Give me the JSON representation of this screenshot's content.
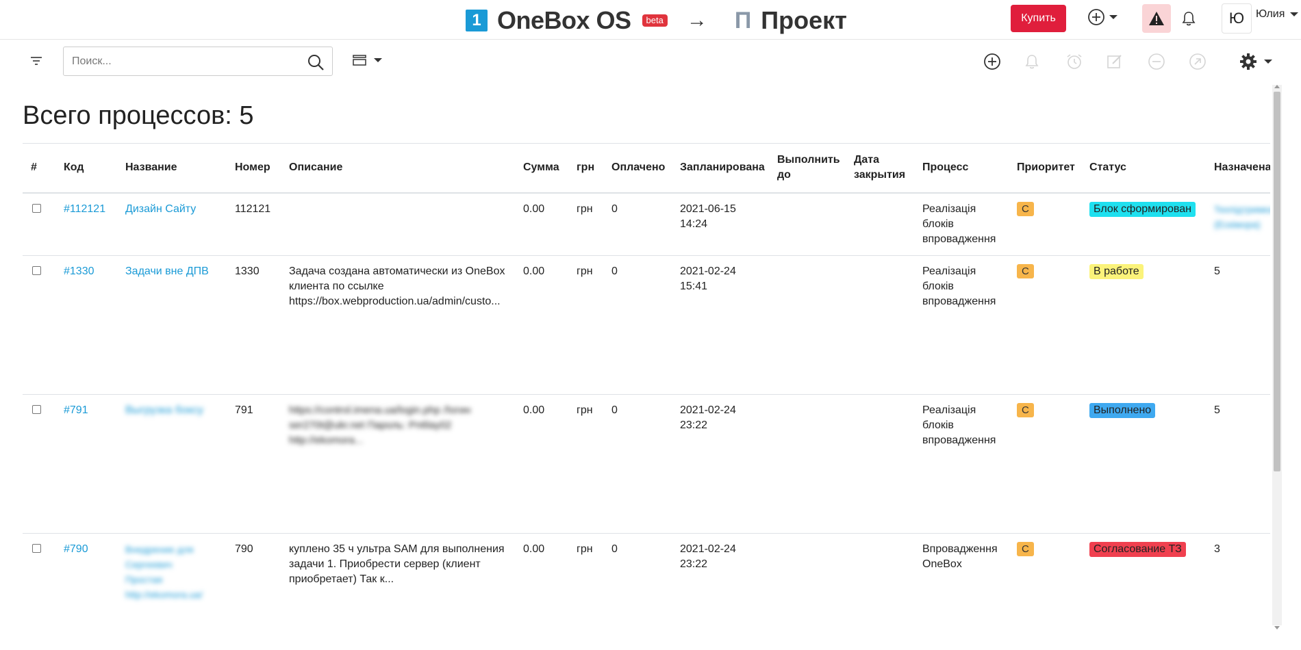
{
  "header": {
    "brand_number": "1",
    "brand_name": "OneBox OS",
    "beta": "beta",
    "arrow": "→",
    "project_icon": "П",
    "project_name": "Проект",
    "buy_label": "Купить",
    "user_initial": "Ю",
    "user_name": "Юлия"
  },
  "toolbar": {
    "search_placeholder": "Поиск...",
    "icons": [
      "plus-circle-icon",
      "bell-icon",
      "alarm-icon",
      "edit-icon",
      "minus-circle-icon",
      "arrow-circle-icon",
      "gear-icon"
    ]
  },
  "main": {
    "title": "Всего процессов: 5"
  },
  "table": {
    "columns": {
      "num": "#",
      "code": "Код",
      "name": "Название",
      "number": "Номер",
      "desc": "Описание",
      "sum": "Сумма",
      "currency": "грн",
      "paid": "Оплачено",
      "planned": "Запланирована",
      "due_1": "Выполнить",
      "due_2": "до",
      "closed_1": "Дата",
      "closed_2": "закрытия",
      "process": "Процесс",
      "priority": "Приоритет",
      "status": "Статус",
      "assigned": "Назначена"
    },
    "rows": [
      {
        "code": "#112121",
        "name": "Дизайн Сайту",
        "number": "112121",
        "desc": "",
        "sum": "0.00",
        "currency": "грн",
        "paid": "0",
        "planned_date": "2021-06-15",
        "planned_time": "14:24",
        "process_1": "Реалізація",
        "process_2": "блоків",
        "process_3": "впровадження",
        "priority": "С",
        "status": "Блок сформирован",
        "status_color": "#1fe0ef",
        "assigned": "Техпідтримка (Ескімора)"
      },
      {
        "code": "#1330",
        "name": "Задачи вне ДПВ",
        "number": "1330",
        "desc_1": "Задача создана автоматически из OneBox",
        "desc_2": "клиента по ссылке",
        "desc_3": "https://box.webproduction.ua/admin/custo...",
        "sum": "0.00",
        "currency": "грн",
        "paid": "0",
        "planned_date": "2021-02-24",
        "planned_time": "15:41",
        "process_1": "Реалізація",
        "process_2": "блоків",
        "process_3": "впровадження",
        "priority": "С",
        "status": "В работе",
        "status_color": "#fbf37a",
        "assigned": "5"
      },
      {
        "code": "#791",
        "name": "Выгрузка боксу",
        "number": "791",
        "desc_1": "https://control.imena.ua/login.php Логин",
        "desc_2": "ser270t@ukr.net Пароль: Pn6lay02",
        "desc_3": "http://ekomora...",
        "sum": "0.00",
        "currency": "грн",
        "paid": "0",
        "planned_date": "2021-02-24",
        "planned_time": "23:22",
        "process_1": "Реалізація",
        "process_2": "блоків",
        "process_3": "впровадження",
        "priority": "С",
        "status": "Выполнено",
        "status_color": "#3fa9f0",
        "assigned": "5"
      },
      {
        "code": "#790",
        "name_1": "Внедрение для",
        "name_2": "Сергеевич",
        "name_3": "Простая",
        "name_4": "http://ekomora.ua/",
        "number": "790",
        "desc_1": "куплено 35 ч ультра SAM для выполнения",
        "desc_2": "задачи 1. Приобрести сервер (клиент",
        "desc_3": "приобретает) Так к...",
        "sum": "0.00",
        "currency": "грн",
        "paid": "0",
        "planned_date": "2021-02-24",
        "planned_time": "23:22",
        "process_1": "Впровадження",
        "process_2": "OneBox",
        "priority": "С",
        "status": "Согласование ТЗ",
        "status_color": "#f0404f",
        "assigned": "3"
      }
    ]
  },
  "colors": {
    "accent": "#1a9ad6",
    "buy": "#e01e3c",
    "warning_bg": "#fad4d6",
    "priority": "#f7b54b"
  }
}
